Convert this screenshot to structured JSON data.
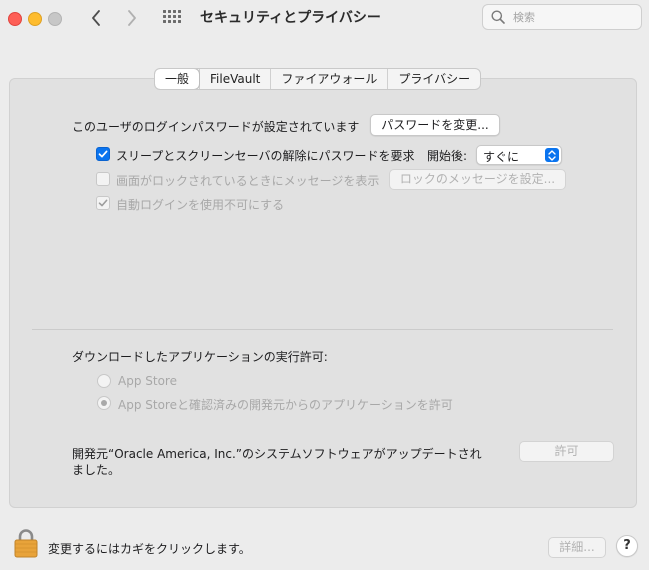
{
  "window": {
    "title": "セキュリティとプライバシー",
    "search_placeholder": "検索"
  },
  "tabs": [
    {
      "label": "一般",
      "active": true
    },
    {
      "label": "FileVault",
      "active": false
    },
    {
      "label": "ファイアウォール",
      "active": false
    },
    {
      "label": "プライバシー",
      "active": false
    }
  ],
  "general": {
    "password_set_text": "このユーザのログインパスワードが設定されています",
    "change_password_button": "パスワードを変更...",
    "require_password": {
      "label": "スリープとスクリーンセーバの解除にパスワードを要求",
      "checked": true,
      "after_label": "開始後:",
      "after_value": "すぐに"
    },
    "show_message": {
      "label": "画面がロックされているときにメッセージを表示",
      "checked": false,
      "enabled": false,
      "button": "ロックのメッセージを設定..."
    },
    "disable_auto_login": {
      "label": "自動ログインを使用不可にする",
      "checked": true,
      "enabled": false
    }
  },
  "downloads": {
    "heading": "ダウンロードしたアプリケーションの実行許可:",
    "options": [
      {
        "label": "App Store",
        "selected": false
      },
      {
        "label": "App Storeと確認済みの開発元からのアプリケーションを許可",
        "selected": true
      }
    ],
    "blocked_message_line1": "開発元“Oracle America, Inc.”のシステムソフトウェアがアップデートされ",
    "blocked_message_line2": "ました。",
    "allow_button": "許可"
  },
  "footer": {
    "lock_text": "変更するにはカギをクリックします。",
    "advanced_button": "詳細...",
    "help_button": "?"
  },
  "colors": {
    "accent": "#0a74ef",
    "close": "#fe5f57",
    "minimize": "#febc2e",
    "lock": "#e8a33a"
  }
}
